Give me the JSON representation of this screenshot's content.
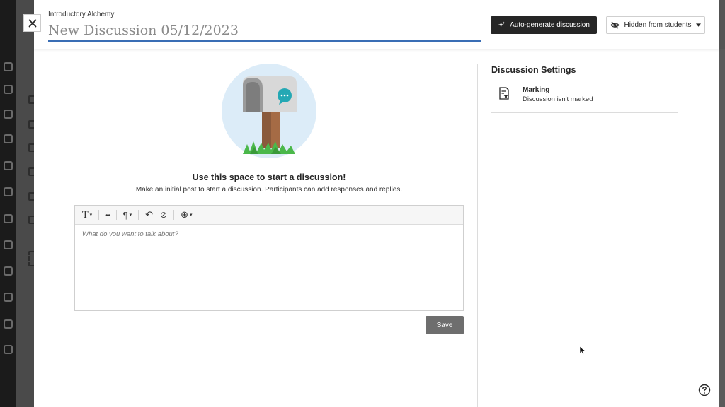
{
  "header": {
    "course_name": "Introductory Alchemy",
    "title_value": "New Discussion 05/12/2023",
    "close_label": "×",
    "auto_generate_label": "Auto-generate discussion",
    "visibility_label": "Hidden from students"
  },
  "empty_state": {
    "title": "Use this space to start a discussion!",
    "description": "Make an initial post to start a discussion. Participants can add responses and replies."
  },
  "editor": {
    "placeholder": "What do you want to talk about?",
    "toolbar": {
      "text_style_label": "T",
      "more_label": "•••",
      "paragraph_label": "¶",
      "undo_label": "↶",
      "link_label": "⊘",
      "insert_label": "⊕",
      "caret": "▾"
    }
  },
  "actions": {
    "save_label": "Save"
  },
  "settings": {
    "title": "Discussion Settings",
    "marking_label": "Marking",
    "marking_value": "Discussion isn't marked"
  },
  "colors": {
    "accent_blue": "#3a6eb5",
    "dark_button": "#262626",
    "save_button": "#6e6e6e",
    "hero_bg": "#dcecf8",
    "chat_bubble": "#24a8b4"
  },
  "icons": {
    "close": "close-icon",
    "auto_generate": "sparkle-icon",
    "visibility": "eye-slash-icon",
    "dropdown": "chevron-down-icon",
    "marking": "marking-icon",
    "help": "help-icon"
  }
}
